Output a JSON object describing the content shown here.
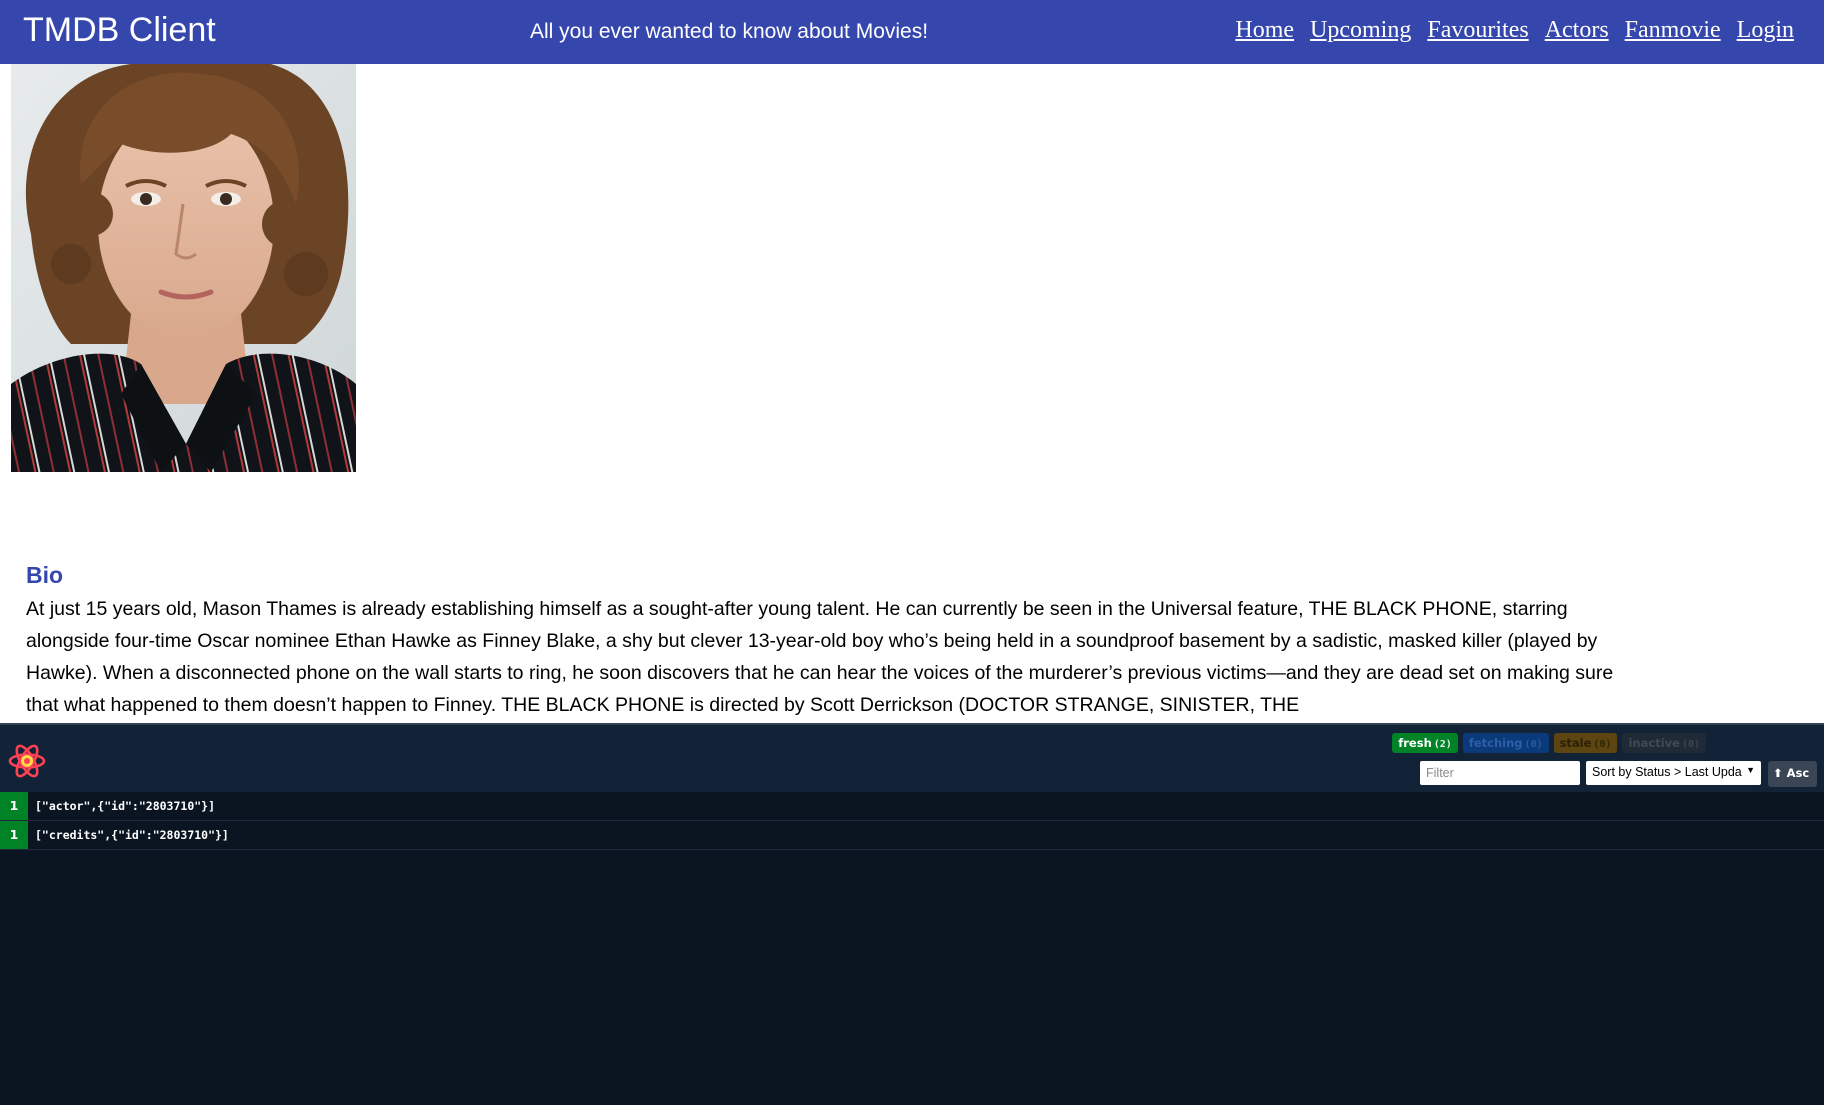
{
  "header": {
    "brand": "TMDB Client",
    "tagline": "All you ever wanted to know about Movies!",
    "nav": [
      "Home",
      "Upcoming",
      "Favourites",
      "Actors",
      "Fanmovie",
      "Login"
    ]
  },
  "bio": {
    "title": "Bio",
    "text": "At just 15 years old, Mason Thames is already establishing himself as a sought-after young talent. He can currently be seen in the Universal feature, THE BLACK PHONE, starring alongside four-time Oscar nominee Ethan Hawke as Finney Blake, a shy but clever 13-year-old boy who’s being held in a soundproof basement by a sadistic, masked killer (played by Hawke). When a disconnected phone on the wall starts to ring, he soon discovers that he can hear the voices of the murderer’s previous victims—and they are dead set on making sure that what happened to them doesn’t happen to Finney. THE BLACK PHONE is directed by Scott Derrickson (DOCTOR STRANGE, SINISTER, THE"
  },
  "devtools": {
    "badges": {
      "fresh": {
        "label": "fresh",
        "count": "(2)"
      },
      "fetching": {
        "label": "fetching",
        "count": "(0)"
      },
      "stale": {
        "label": "stale",
        "count": "(0)"
      },
      "inactive": {
        "label": "inactive",
        "count": "(0)"
      }
    },
    "filter_placeholder": "Filter",
    "sort_label": "Sort by Status > Last Upda",
    "asc_label": "⬆ Asc",
    "queries": [
      {
        "count": "1",
        "key": "[\"actor\",{\"id\":\"2803710\"}]"
      },
      {
        "count": "1",
        "key": "[\"credits\",{\"id\":\"2803710\"}]"
      }
    ]
  },
  "colors": {
    "appbar": "#3546ad",
    "bio_title": "#3546ad",
    "devtools_bg": "#0b1521",
    "fresh": "#008327"
  }
}
